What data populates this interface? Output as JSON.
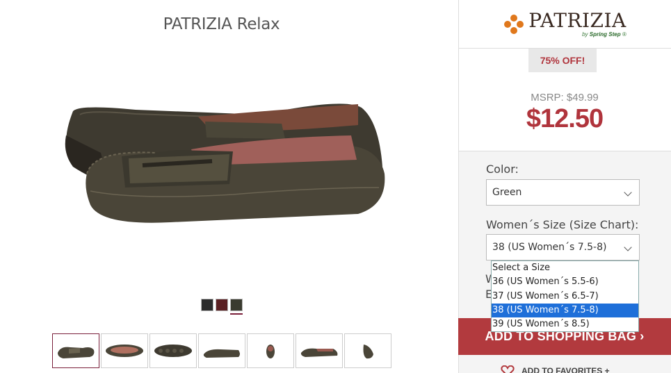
{
  "product": {
    "title": "PATRIZIA Relax"
  },
  "swatches": [
    {
      "name": "Black",
      "color": "#2b2b2b"
    },
    {
      "name": "Burgundy",
      "color": "#5a1f22"
    },
    {
      "name": "Green",
      "color": "#3a3b30"
    }
  ],
  "brand": {
    "logo_text": "PATRIZIA",
    "logo_sub_prefix": "by ",
    "logo_sub_brand": "Spring Step"
  },
  "pricing": {
    "discount_badge": "75% OFF!",
    "msrp": "MSRP: $49.99",
    "sale_price": "$12.50"
  },
  "options": {
    "color_label": "Color:",
    "color_value": "Green",
    "size_label": "Women´s Size (Size Chart):",
    "size_value": "38 (US Women´s 7.5-8)",
    "partial_hidden_1": "W",
    "partial_hidden_2": "E"
  },
  "size_dropdown": {
    "items": [
      "Select a Size",
      "36 (US Women´s 5.5-6)",
      "37 (US Women´s 6.5-7)",
      "38 (US Women´s 7.5-8)",
      "39 (US Women´s 8.5)"
    ]
  },
  "actions": {
    "add_to_bag": "ADD TO SHOPPING BAG ›",
    "add_to_favorites": "ADD TO FAVORITES +"
  },
  "colors": {
    "accent": "#b23a3e",
    "highlight": "#1e6fd9"
  }
}
